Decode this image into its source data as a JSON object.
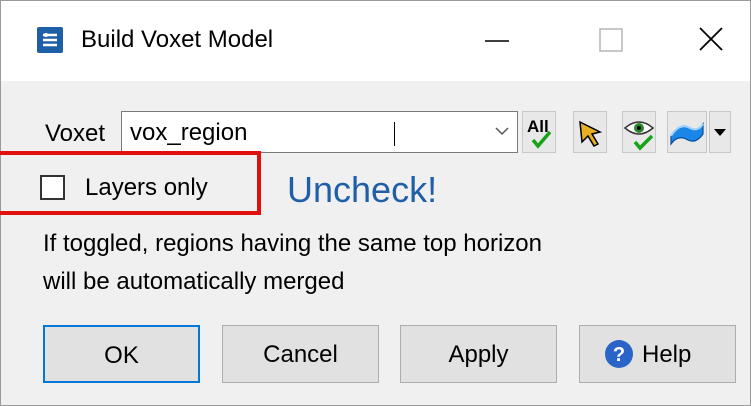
{
  "window": {
    "title": "Build Voxet Model",
    "controls": {
      "minimize": "minimize-icon",
      "maximize": "maximize-icon",
      "close": "close-icon"
    }
  },
  "voxet": {
    "label": "Voxet",
    "value": "vox_region",
    "toolbar": {
      "all_label": "All",
      "icons": [
        "all-check-icon",
        "pick-arrow-icon",
        "eye-check-icon",
        "surface-icon",
        "dropdown-arrow-icon"
      ]
    }
  },
  "layers_only": {
    "label": "Layers only",
    "checked": false,
    "annotation": "Uncheck!"
  },
  "help_text": {
    "line1": "If toggled, regions having the same top horizon",
    "line2": "will be automatically merged"
  },
  "buttons": {
    "ok": "OK",
    "cancel": "Cancel",
    "apply": "Apply",
    "help": "Help"
  },
  "colors": {
    "highlight": "#e11010",
    "annotation": "#1f5fa8",
    "default_button_border": "#0078d7"
  }
}
